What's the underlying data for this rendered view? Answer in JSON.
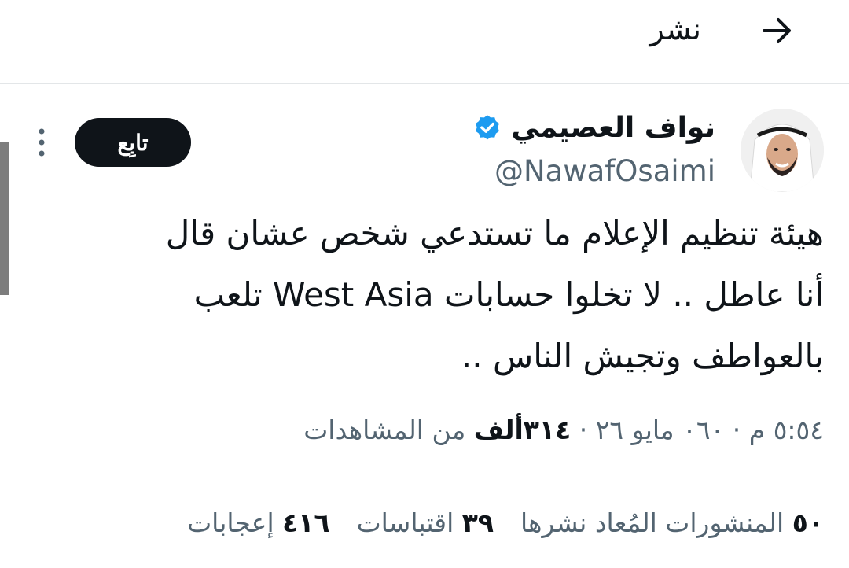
{
  "header": {
    "title": "نشر",
    "back_icon": "arrow-right-icon"
  },
  "tweet": {
    "author": {
      "name": "نواف العصيمي",
      "handle": "@NawafOsaimi",
      "verified_icon": "verified-badge-icon",
      "verified_color": "#1d9bf0"
    },
    "follow_label": "تابِع",
    "more_icon": "more-vertical-icon",
    "text_lines": [
      "هيئة تنظيم الإعلام ما تستدعي شخص عشان قال",
      "أنا عاطل .. لا تخلوا حسابات West Asia تلعب",
      "بالعواطف وتجيش الناس .."
    ],
    "meta": {
      "time": "٥:٥٤ م",
      "date": "٠٦٠ مايو ٢٦",
      "separator": " · ",
      "views_count": "٣١٤ألف",
      "views_label": "من المشاهدات"
    },
    "stats": [
      {
        "count": "٥٠",
        "label": "المنشورات المُعاد نشرها"
      },
      {
        "count": "٣٩",
        "label": "اقتباسات"
      },
      {
        "count": "٤١٦",
        "label": "إعجابات"
      }
    ]
  },
  "colors": {
    "text_primary": "#0f1419",
    "text_secondary": "#536471",
    "follow_bg": "#0f1419",
    "divider": "#e3e6e8"
  }
}
